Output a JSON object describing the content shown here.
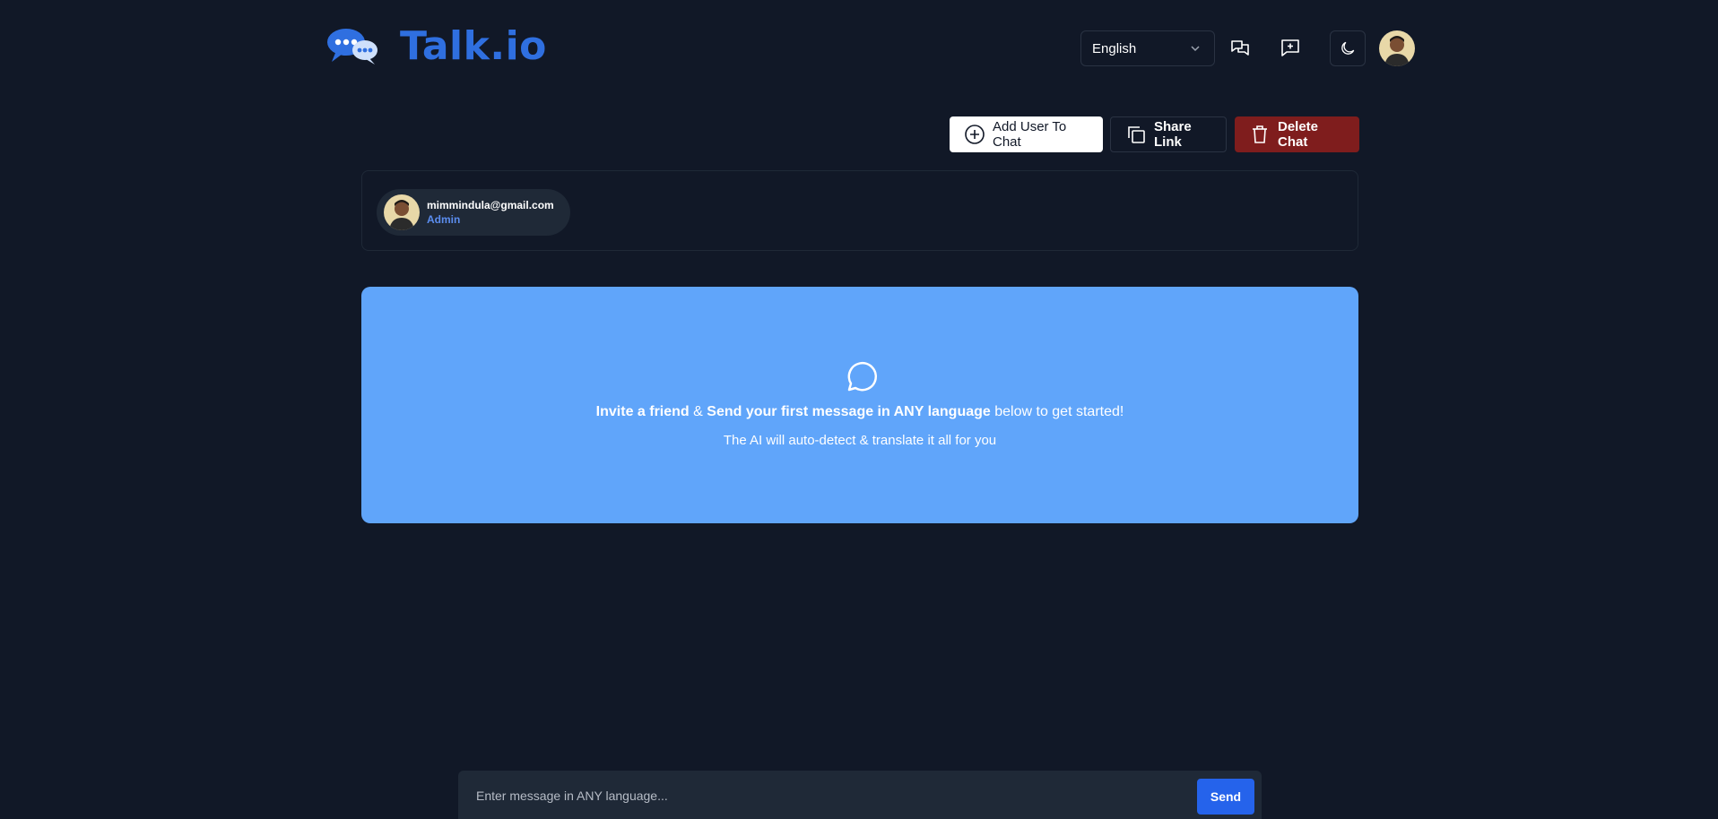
{
  "header": {
    "brand": "Talk.io",
    "language_selected": "English",
    "icons": {
      "chats": "chats-icon",
      "new_chat": "message-plus-icon",
      "theme": "moon-icon",
      "profile": "user-avatar"
    }
  },
  "actions": {
    "add_user": "Add User To Chat",
    "share_link": "Share Link",
    "delete_chat": "Delete Chat"
  },
  "members": [
    {
      "email": "mimmindula@gmail.com",
      "role": "Admin"
    }
  ],
  "empty_state": {
    "part1_bold": "Invite a friend",
    "part2": " & ",
    "part3_bold": "Send your first message in ANY language",
    "part4": " below to get started!",
    "subtitle": "The AI will auto-detect & translate it all for you"
  },
  "composer": {
    "placeholder": "Enter message in ANY language...",
    "send_label": "Send"
  },
  "colors": {
    "background": "#111827",
    "brand": "#2f6fe0",
    "panel": "#60a5fa",
    "danger": "#7f1d1d",
    "send": "#2563eb",
    "role": "#5b8def"
  }
}
